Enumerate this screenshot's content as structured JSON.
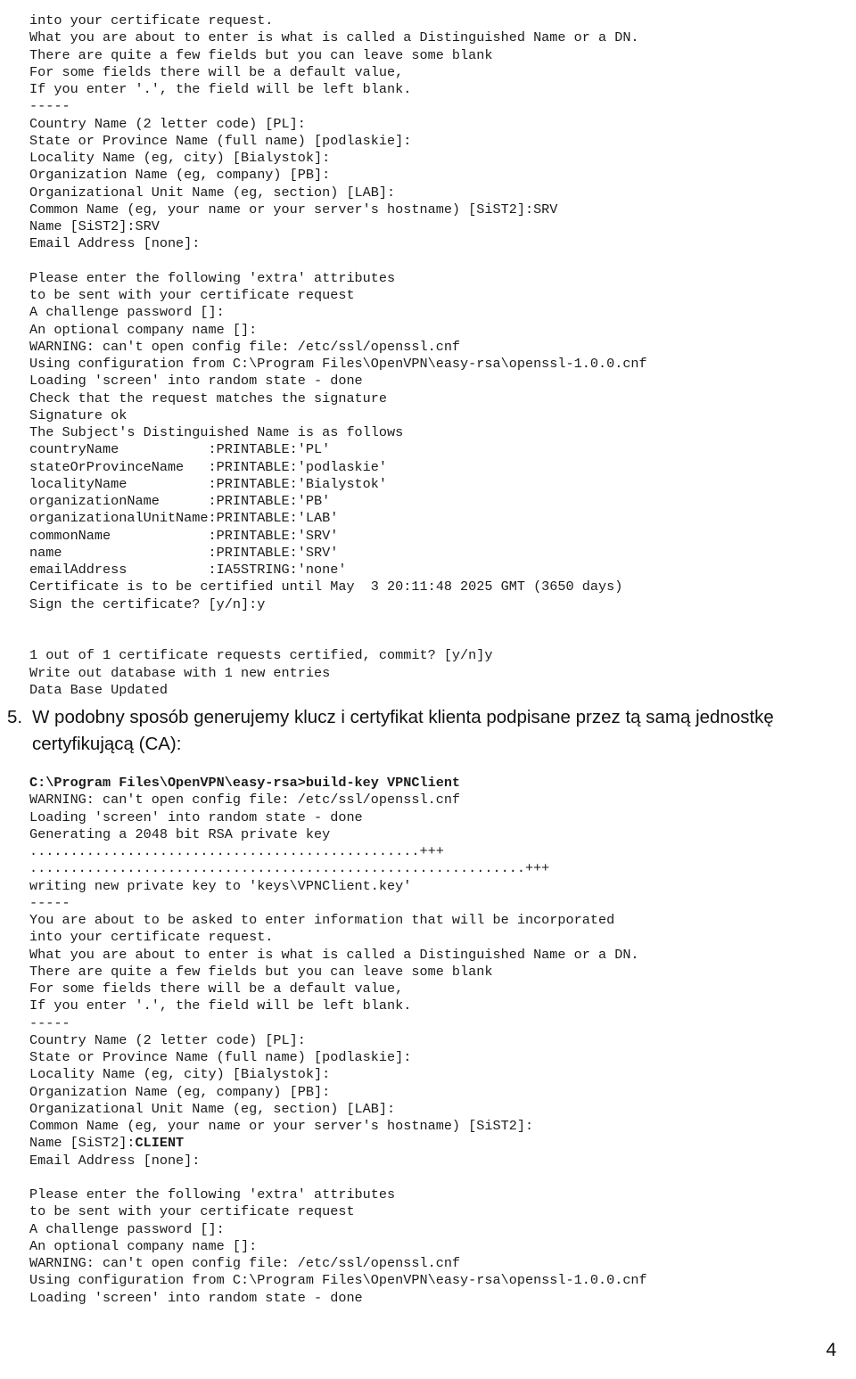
{
  "document": {
    "page_number": "4",
    "language": "pl"
  },
  "console_top": {
    "lines": [
      "into your certificate request.",
      "What you are about to enter is what is called a Distinguished Name or a DN.",
      "There are quite a few fields but you can leave some blank",
      "For some fields there will be a default value,",
      "If you enter '.', the field will be left blank.",
      "-----",
      "Country Name (2 letter code) [PL]:",
      "State or Province Name (full name) [podlaskie]:",
      "Locality Name (eg, city) [Bialystok]:",
      "Organization Name (eg, company) [PB]:",
      "Organizational Unit Name (eg, section) [LAB]:",
      "Common Name (eg, your name or your server's hostname) [SiST2]:SRV",
      "Name [SiST2]:SRV",
      "Email Address [none]:",
      "",
      "Please enter the following 'extra' attributes",
      "to be sent with your certificate request",
      "A challenge password []:",
      "An optional company name []:",
      "WARNING: can't open config file: /etc/ssl/openssl.cnf",
      "Using configuration from C:\\Program Files\\OpenVPN\\easy-rsa\\openssl-1.0.0.cnf",
      "Loading 'screen' into random state - done",
      "Check that the request matches the signature",
      "Signature ok",
      "The Subject's Distinguished Name is as follows",
      "countryName           :PRINTABLE:'PL'",
      "stateOrProvinceName   :PRINTABLE:'podlaskie'",
      "localityName          :PRINTABLE:'Bialystok'",
      "organizationName      :PRINTABLE:'PB'",
      "organizationalUnitName:PRINTABLE:'LAB'",
      "commonName            :PRINTABLE:'SRV'",
      "name                  :PRINTABLE:'SRV'",
      "emailAddress          :IA5STRING:'none'",
      "Certificate is to be certified until May  3 20:11:48 2025 GMT (3650 days)",
      "Sign the certificate? [y/n]:y",
      "",
      "",
      "1 out of 1 certificate requests certified, commit? [y/n]y",
      "Write out database with 1 new entries",
      "Data Base Updated"
    ]
  },
  "instruction": {
    "marker": "5.",
    "text": "W podobny sposób generujemy klucz i certyfikat klienta podpisane przez tą samą jednostkę certyfikującą (CA):"
  },
  "console_mid": {
    "command_line": "C:\\Program Files\\OpenVPN\\easy-rsa>build-key VPNClient",
    "lines": [
      "WARNING: can't open config file: /etc/ssl/openssl.cnf",
      "Loading 'screen' into random state - done",
      "Generating a 2048 bit RSA private key",
      "................................................+++",
      ".............................................................+++",
      "writing new private key to 'keys\\VPNClient.key'",
      "-----",
      "You are about to be asked to enter information that will be incorporated",
      "into your certificate request.",
      "What you are about to enter is what is called a Distinguished Name or a DN.",
      "There are quite a few fields but you can leave some blank",
      "For some fields there will be a default value,",
      "If you enter '.', the field will be left blank.",
      "-----",
      "Country Name (2 letter code) [PL]:",
      "State or Province Name (full name) [podlaskie]:",
      "Locality Name (eg, city) [Bialystok]:",
      "Organization Name (eg, company) [PB]:",
      "Organizational Unit Name (eg, section) [LAB]:",
      "Common Name (eg, your name or your server's hostname) [SiST2]:"
    ],
    "name_prompt_prefix": "Name [SiST2]:",
    "name_prompt_value": "CLIENT",
    "lines_after": [
      "Email Address [none]:",
      "",
      "Please enter the following 'extra' attributes",
      "to be sent with your certificate request",
      "A challenge password []:",
      "An optional company name []:",
      "WARNING: can't open config file: /etc/ssl/openssl.cnf",
      "Using configuration from C:\\Program Files\\OpenVPN\\easy-rsa\\openssl-1.0.0.cnf",
      "Loading 'screen' into random state - done"
    ]
  }
}
